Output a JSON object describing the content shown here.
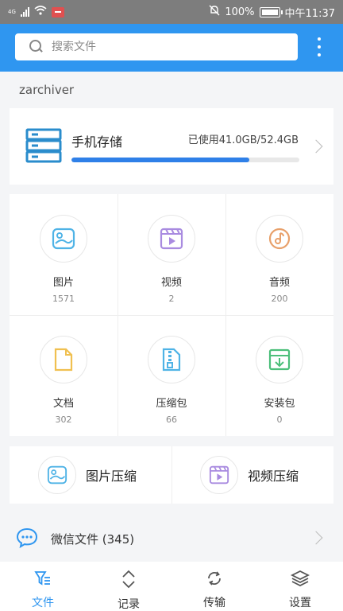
{
  "status_bar": {
    "network": "4G",
    "battery_percent": "100%",
    "time": "中午11:37"
  },
  "search": {
    "placeholder": "搜索文件"
  },
  "folder_label": "zarchiver",
  "storage": {
    "title": "手机存储",
    "used_text": "已使用41.0GB/52.4GB",
    "used_fraction": 0.78
  },
  "categories": [
    {
      "label": "图片",
      "count": "1571",
      "icon": "image-icon",
      "color": "#4fb3e6"
    },
    {
      "label": "视频",
      "count": "2",
      "icon": "video-icon",
      "color": "#a98be0"
    },
    {
      "label": "音频",
      "count": "200",
      "icon": "audio-icon",
      "color": "#e8a06a"
    },
    {
      "label": "文档",
      "count": "302",
      "icon": "document-icon",
      "color": "#f0c050"
    },
    {
      "label": "压缩包",
      "count": "66",
      "icon": "archive-icon",
      "color": "#4fb3e6"
    },
    {
      "label": "安装包",
      "count": "0",
      "icon": "package-icon",
      "color": "#4cbf7a"
    }
  ],
  "compress": [
    {
      "label": "图片压缩",
      "icon": "image-icon"
    },
    {
      "label": "视频压缩",
      "icon": "video-icon"
    }
  ],
  "wechat": {
    "label": "微信文件 (345)"
  },
  "tabs": [
    {
      "label": "文件",
      "icon": "filter-icon",
      "active": true
    },
    {
      "label": "记录",
      "icon": "record-icon",
      "active": false
    },
    {
      "label": "传输",
      "icon": "transfer-icon",
      "active": false
    },
    {
      "label": "设置",
      "icon": "layers-icon",
      "active": false
    }
  ],
  "colors": {
    "accent": "#2f96f0",
    "progress": "#2f80e8"
  }
}
